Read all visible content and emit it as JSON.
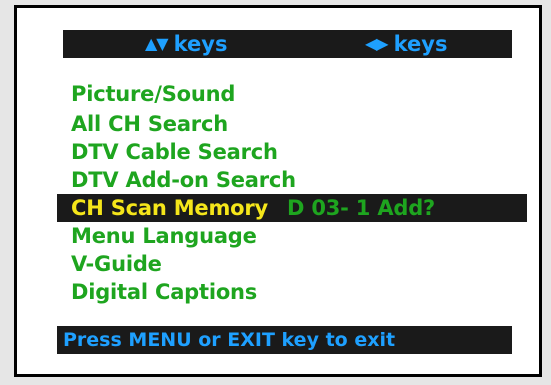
{
  "header": {
    "updown_glyph": "▲▼",
    "updown_label": "keys",
    "leftright_glyph": "◀▶",
    "leftright_label": "keys"
  },
  "menu": {
    "items": [
      {
        "label": "Picture/Sound"
      },
      {
        "label": "All CH Search"
      },
      {
        "label": "DTV Cable Search"
      },
      {
        "label": "DTV Add-on Search"
      },
      {
        "label": "CH Scan Memory",
        "value": "D 03-  1 Add?",
        "selected": true
      },
      {
        "label": "Menu Language"
      },
      {
        "label": "V-Guide"
      },
      {
        "label": "Digital Captions"
      }
    ]
  },
  "footer": {
    "text": "Press MENU or EXIT key to exit"
  },
  "colors": {
    "menu_text": "#1ea51f",
    "selected_text": "#f5e61a",
    "accent_blue": "#1ea0ff",
    "bar_background": "#1a1a1a"
  }
}
